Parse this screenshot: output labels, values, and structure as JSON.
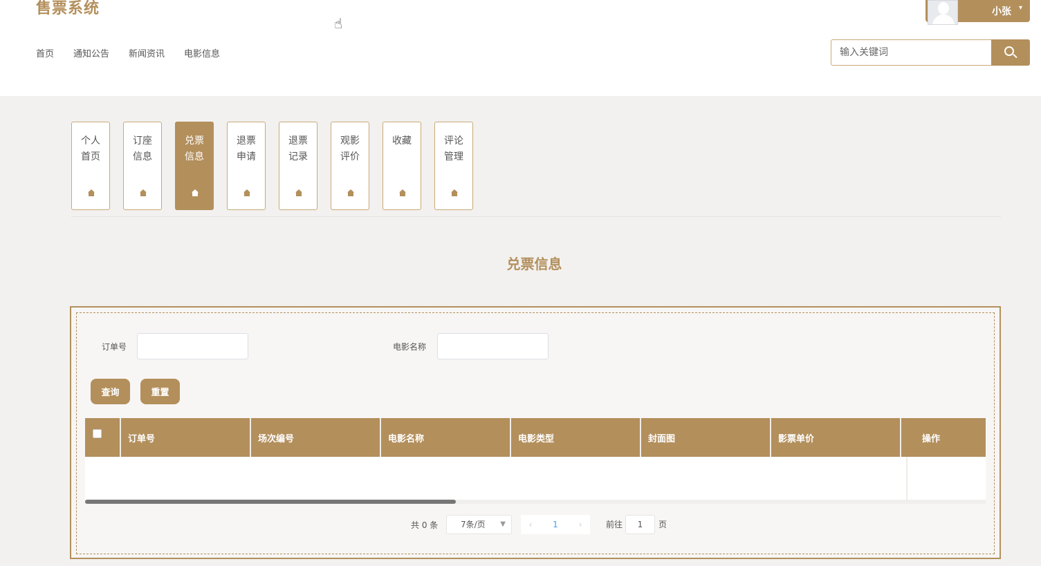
{
  "app": {
    "title": "售票系统"
  },
  "nav": {
    "items": [
      "首页",
      "通知公告",
      "新闻资讯",
      "电影信息"
    ]
  },
  "user": {
    "name": "小张"
  },
  "search": {
    "placeholder": "输入关键词"
  },
  "tabs": [
    {
      "label": "个人首页",
      "active": false
    },
    {
      "label": "订座信息",
      "active": false
    },
    {
      "label": "兑票信息",
      "active": true
    },
    {
      "label": "退票申请",
      "active": false
    },
    {
      "label": "退票记录",
      "active": false
    },
    {
      "label": "观影评价",
      "active": false
    },
    {
      "label": "收藏",
      "active": false
    },
    {
      "label": "评论管理",
      "active": false
    }
  ],
  "page": {
    "title": "兑票信息"
  },
  "filters": {
    "order_no_label": "订单号",
    "order_no_value": "",
    "movie_name_label": "电影名称",
    "movie_name_value": ""
  },
  "buttons": {
    "query": "查询",
    "reset": "重置"
  },
  "table": {
    "columns": [
      "订单号",
      "场次编号",
      "电影名称",
      "电影类型",
      "封面图",
      "影票单价",
      "操作"
    ],
    "rows": []
  },
  "pagination": {
    "total_text": "共 0 条",
    "page_size": "7条/页",
    "current_page": "1",
    "goto_label": "前往",
    "goto_value": "1",
    "goto_suffix": "页"
  },
  "colors": {
    "accent": "#b38f5c",
    "background": "#f2f1ef"
  },
  "icons": {
    "tab_icon": "home-icon",
    "search_icon": "search-icon"
  }
}
